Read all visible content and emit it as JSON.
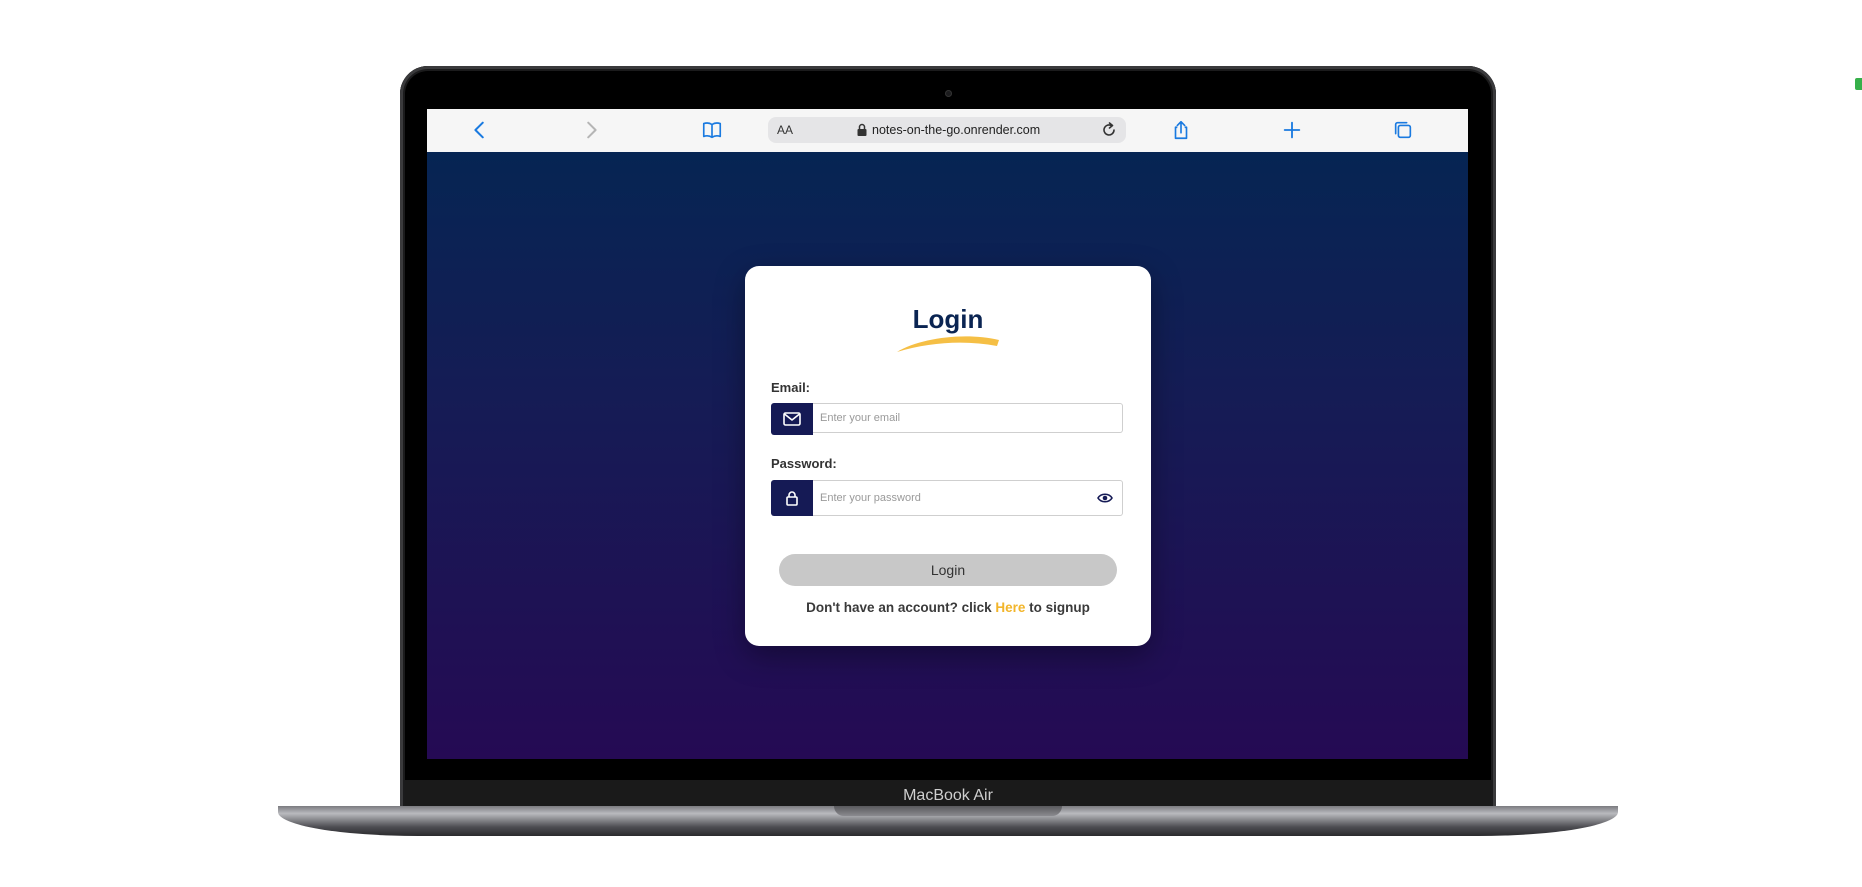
{
  "device": {
    "brand_label": "MacBook Air"
  },
  "browser": {
    "toolbar_icons": [
      "chevron-left-icon",
      "chevron-right-icon",
      "book-icon",
      "share-icon",
      "plus-icon",
      "tabs-icon"
    ],
    "reader_label": "AA",
    "url": "notes-on-the-go.onrender.com"
  },
  "login": {
    "title": "Login",
    "email_label": "Email:",
    "email_placeholder": "Enter your email",
    "password_label": "Password:",
    "password_placeholder": "Enter your password",
    "button_label": "Login",
    "signup_prefix": "Don't have an account? click ",
    "signup_link": "Here",
    "signup_suffix": " to signup"
  },
  "colors": {
    "page_gradient_top": "#062553",
    "page_gradient_bottom": "#250a54",
    "accent": "#f2b52a",
    "icon_bg": "#151a55",
    "title": "#0a2452",
    "link": "#1a7ae0"
  }
}
